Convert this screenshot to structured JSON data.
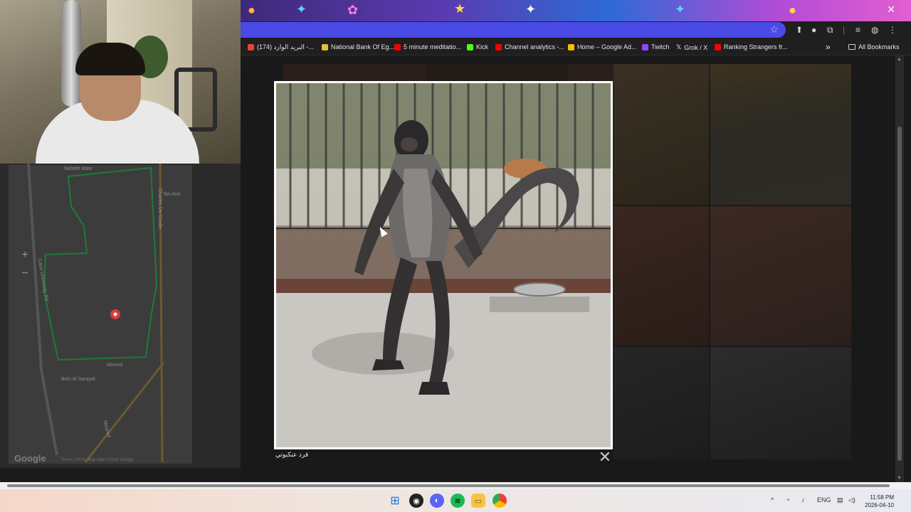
{
  "browser": {
    "bookmarks": [
      {
        "label": "(174) البريد الوارد -...",
        "icon": "gmail-icon",
        "color": "#ea4335"
      },
      {
        "label": "National Bank Of Eg...",
        "icon": "bank-icon",
        "color": "#e0c23a"
      },
      {
        "label": "5 minute meditatio...",
        "icon": "youtube-icon",
        "color": "#ff0000"
      },
      {
        "label": "Kick",
        "icon": "kick-icon",
        "color": "#53fc18"
      },
      {
        "label": "Channel analytics -...",
        "icon": "youtube-icon",
        "color": "#ff0000"
      },
      {
        "label": "Home – Google Ad...",
        "icon": "google-ads-icon",
        "color": "#fbbc04"
      },
      {
        "label": "Twitch",
        "icon": "twitch-icon",
        "color": "#9146ff"
      },
      {
        "label": "Grok / X",
        "icon": "x-icon",
        "color": "#ffffff"
      },
      {
        "label": "Ranking Strangers fr...",
        "icon": "youtube-icon",
        "color": "#ff0000"
      }
    ],
    "overflow_label": "»",
    "all_bookmarks_label": "All Bookmarks"
  },
  "map": {
    "labels": {
      "nahdet_masr": "Nahdet Masr",
      "cairo_univ": "Cairo University Rd",
      "charles": "Charles De Gaulle",
      "ibn_amr": "Ibn Amr",
      "bein_al_sarayat": "Bein Al Sarayat",
      "murad": "Mourad",
      "ahmed": "Ahmed",
      "google": "Google",
      "footer": "Terms   100 m   Map data ©2026 Google"
    },
    "zoom_in": "+",
    "zoom_out": "−"
  },
  "lightbox": {
    "caption": "قرد عنكبوتي",
    "close": "✕"
  },
  "taskbar": {
    "lang": "ENG",
    "time": "11:58 PM",
    "date": "2026-04-10"
  }
}
